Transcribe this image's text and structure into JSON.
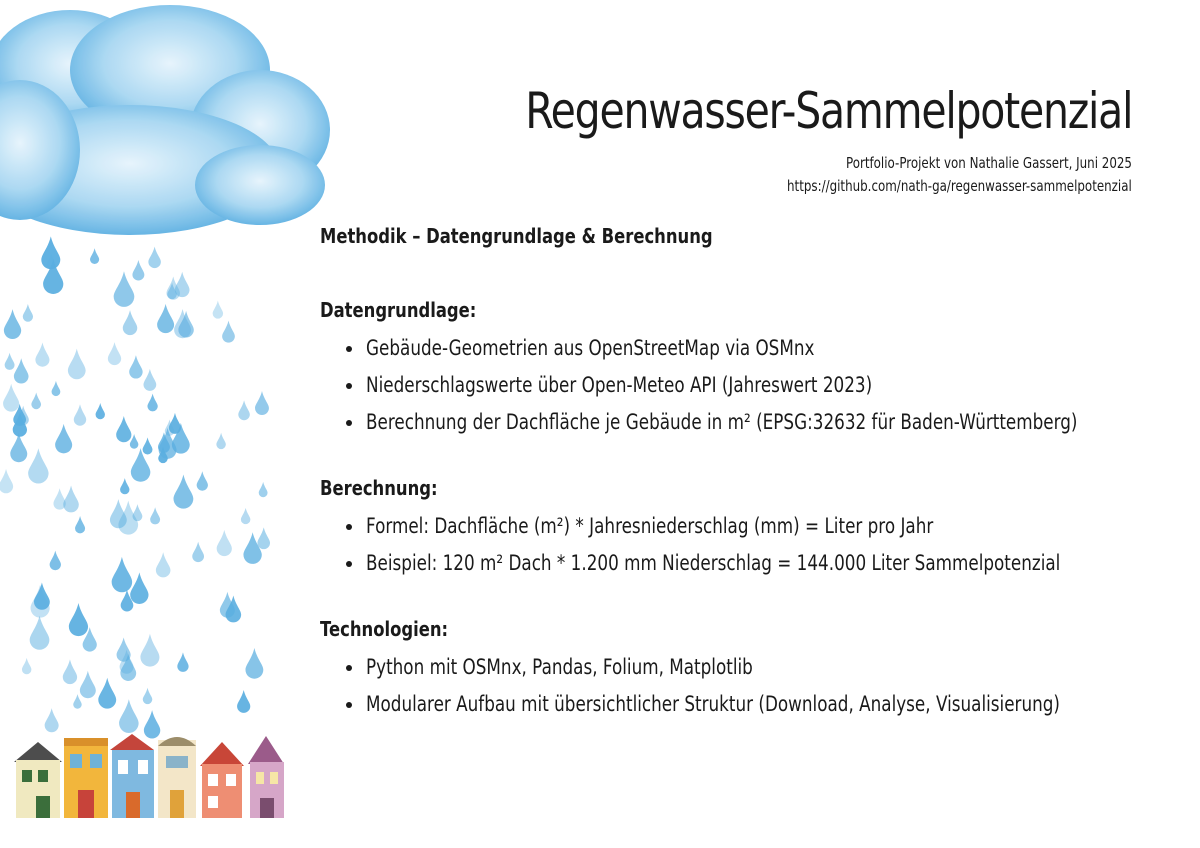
{
  "header": {
    "title": "Regenwasser-Sammelpotenzial",
    "subtitle": "Portfolio-Projekt von Nathalie Gassert, Juni 2025",
    "url": "https://github.com/nath-ga/regenwasser-sammelpotenzial"
  },
  "content": {
    "heading": "Methodik – Datengrundlage & Berechnung",
    "sections": [
      {
        "title": "Datengrundlage:",
        "items": [
          "Gebäude-Geometrien aus OpenStreetMap via OSMnx",
          "Niederschlagswerte über Open-Meteo API (Jahreswert 2023)",
          "Berechnung der Dachfläche je Gebäude in m² (EPSG:32632 für Baden-Württemberg)"
        ]
      },
      {
        "title": "Berechnung:",
        "items": [
          "Formel: Dachfläche (m²) * Jahresniederschlag (mm) = Liter pro Jahr",
          "Beispiel: 120 m² Dach * 1.200 mm Niederschlag = 144.000 Liter Sammelpotenzial"
        ]
      },
      {
        "title": "Technologien:",
        "items": [
          "Python mit OSMnx, Pandas, Folium, Matplotlib",
          "Modularer Aufbau mit übersichtlicher Struktur (Download, Analyse, Visualisierung)"
        ]
      }
    ]
  },
  "colors": {
    "cloud": "#7fc3ea",
    "drop": "#5aaee0",
    "text": "#1a1a1a"
  }
}
